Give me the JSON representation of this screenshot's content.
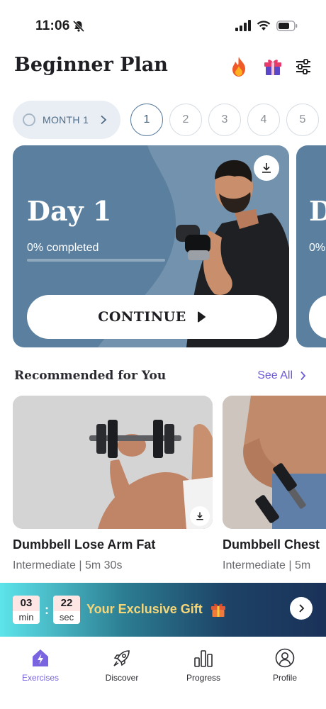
{
  "status_bar": {
    "time": "11:06"
  },
  "header": {
    "title": "Beginner Plan"
  },
  "month_selector": {
    "label": "MONTH 1"
  },
  "days": [
    "1",
    "2",
    "3",
    "4",
    "5"
  ],
  "day_card": {
    "title": "Day 1",
    "progress_text": "0% completed",
    "progress_fraction": 0.0,
    "continue_label": "CONTINUE"
  },
  "day_card_peek": {
    "title": "D",
    "progress_text": "0%"
  },
  "recommended": {
    "title": "Recommended for You",
    "see_all": "See All",
    "items": [
      {
        "title": "Dumbbell Lose Arm Fat",
        "meta": "Intermediate | 5m 30s"
      },
      {
        "title": "Dumbbell Chest",
        "meta": "Intermediate | 5m"
      }
    ]
  },
  "gift_banner": {
    "minutes": "03",
    "minutes_unit": "min",
    "seconds": "22",
    "seconds_unit": "sec",
    "colon": ":",
    "text": "Your Exclusive Gift"
  },
  "tabs": [
    {
      "label": "Exercises",
      "icon": "exercises-icon",
      "active": true
    },
    {
      "label": "Discover",
      "icon": "rocket-icon",
      "active": false
    },
    {
      "label": "Progress",
      "icon": "bar-chart-icon",
      "active": false
    },
    {
      "label": "Profile",
      "icon": "profile-icon",
      "active": false
    }
  ],
  "colors": {
    "accent": "#7a64e0",
    "card": "#5b7f9e",
    "gift_text": "#f5d77a"
  }
}
